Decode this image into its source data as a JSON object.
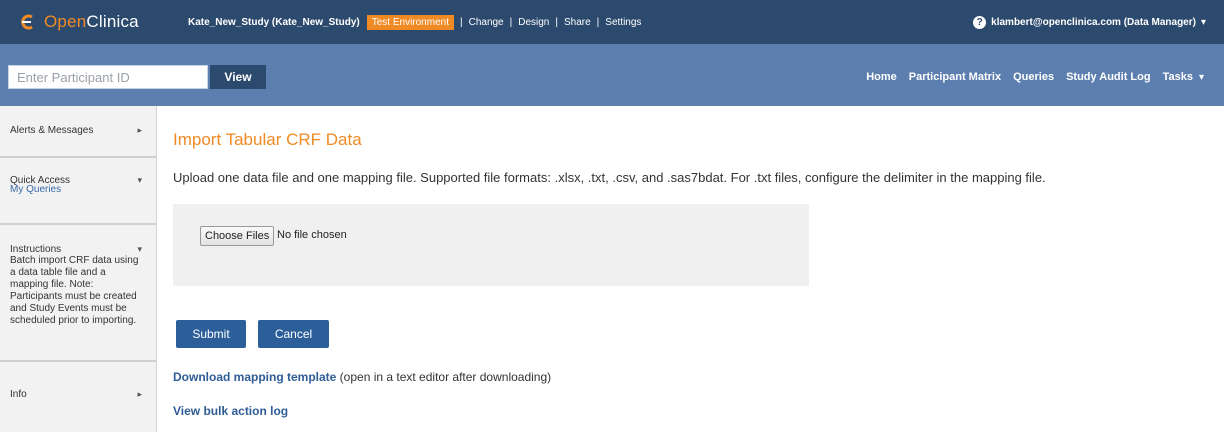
{
  "colors": {
    "topbar": "#2c4a6e",
    "navbar": "#5d7fb0",
    "accent_orange": "#f08a24",
    "button_blue": "#2c5f9a",
    "link_blue": "#2f5d95"
  },
  "header": {
    "logo_open": "Open",
    "logo_clinica": "Clinica",
    "study_name": "Kate_New_Study (Kate_New_Study)",
    "environment_badge": "Test Environment",
    "sep": "|",
    "links": [
      "Change",
      "Design",
      "Share",
      "Settings"
    ],
    "help_icon": "?",
    "user": "klambert@openclinica.com (Data Manager)",
    "user_caret": "▾"
  },
  "navbar": {
    "participant_placeholder": "Enter Participant ID",
    "view_label": "View",
    "items": [
      "Home",
      "Participant Matrix",
      "Queries",
      "Study Audit Log",
      "Tasks"
    ],
    "tasks_caret": "▾"
  },
  "sidebar": {
    "alerts_label": "Alerts & Messages",
    "alerts_caret": "▸",
    "quick_access_label": "Quick Access",
    "quick_access_caret": "▾",
    "quick_access_link": "My Queries",
    "instructions_label": "Instructions",
    "instructions_caret": "▾",
    "instructions_text": "Batch import CRF data using a data table file and a mapping file. Note: Participants must be created and Study Events must be scheduled prior to importing.",
    "info_label": "Info",
    "info_caret": "▸"
  },
  "main": {
    "title": "Import Tabular CRF Data",
    "description": "Upload one data file and one mapping file. Supported file formats: .xlsx, .txt, .csv, and .sas7bdat. For .txt files, configure the delimiter in the mapping file.",
    "choose_files_label": "Choose Files",
    "file_status": "No file chosen",
    "submit_label": "Submit",
    "cancel_label": "Cancel",
    "download_link": "Download mapping template",
    "download_note": " (open in a text editor after downloading)",
    "bulk_log_link": "View bulk action log"
  }
}
